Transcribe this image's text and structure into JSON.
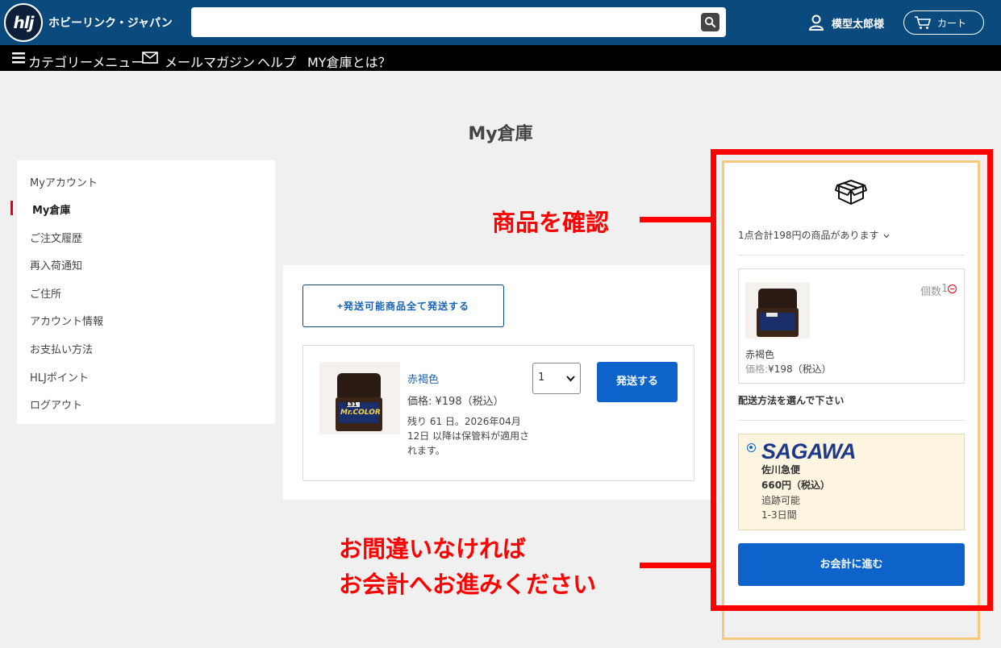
{
  "header": {
    "logo_text": "hlj",
    "brand_name": "ホビーリンク・ジャパン",
    "search": {
      "value": "",
      "placeholder": ""
    },
    "user_name": "模型太郎様",
    "cart_label": "カート"
  },
  "nav": {
    "items": [
      {
        "label": "カテゴリーメニュー"
      },
      {
        "label": "メールマガジン"
      },
      {
        "label": "ヘルプ"
      },
      {
        "label": "MY倉庫とは？"
      }
    ]
  },
  "page_title": "My倉庫",
  "sidebar": {
    "items": [
      {
        "label": "Myアカウント"
      },
      {
        "label": "My倉庫",
        "active": true
      },
      {
        "label": "ご注文履歴"
      },
      {
        "label": "再入荷通知"
      },
      {
        "label": "ご住所"
      },
      {
        "label": "アカウント情報"
      },
      {
        "label": "お支払い方法"
      },
      {
        "label": "HLJポイント"
      },
      {
        "label": "ログアウト"
      }
    ]
  },
  "main": {
    "ship_all_label": "+発送可能商品全て発送する",
    "item": {
      "name": "赤褐色",
      "price": "価格: ¥198（税込）",
      "note": "残り 61 日。2026年04月12日 以降は保管料が適用されます。",
      "qty": "1",
      "ship_label": "発送する",
      "image_text": "Mr.COLOR",
      "image_number": "131"
    }
  },
  "right_panel": {
    "summary": "1点合計198円の商品があります",
    "qty_label": "個数",
    "qty_value": "1",
    "item_name": "赤褐色",
    "item_price_label": "価格:",
    "item_price_value": "¥198（税込）",
    "ship_method_label": "配送方法を選んで下さい",
    "carrier": {
      "logo": "SAGAWA",
      "name": "佐川急便",
      "price": "660円（税込）",
      "tracking": "追跡可能",
      "days": "1-3日間"
    },
    "checkout_label": "お会計に進む"
  },
  "annotations": {
    "check_items": "商品を確認",
    "proceed_line1": "お間違いなければ",
    "proceed_line2": "お会計へお進みください"
  },
  "colors": {
    "header_bg": "#0a4a7c",
    "nav_bg": "#000000",
    "primary_button": "#0d63c9",
    "link": "#1763b5",
    "annotation_red": "#ff0000",
    "frame_orange": "#f7c97a",
    "ship_option_bg": "#fdf5e0"
  }
}
